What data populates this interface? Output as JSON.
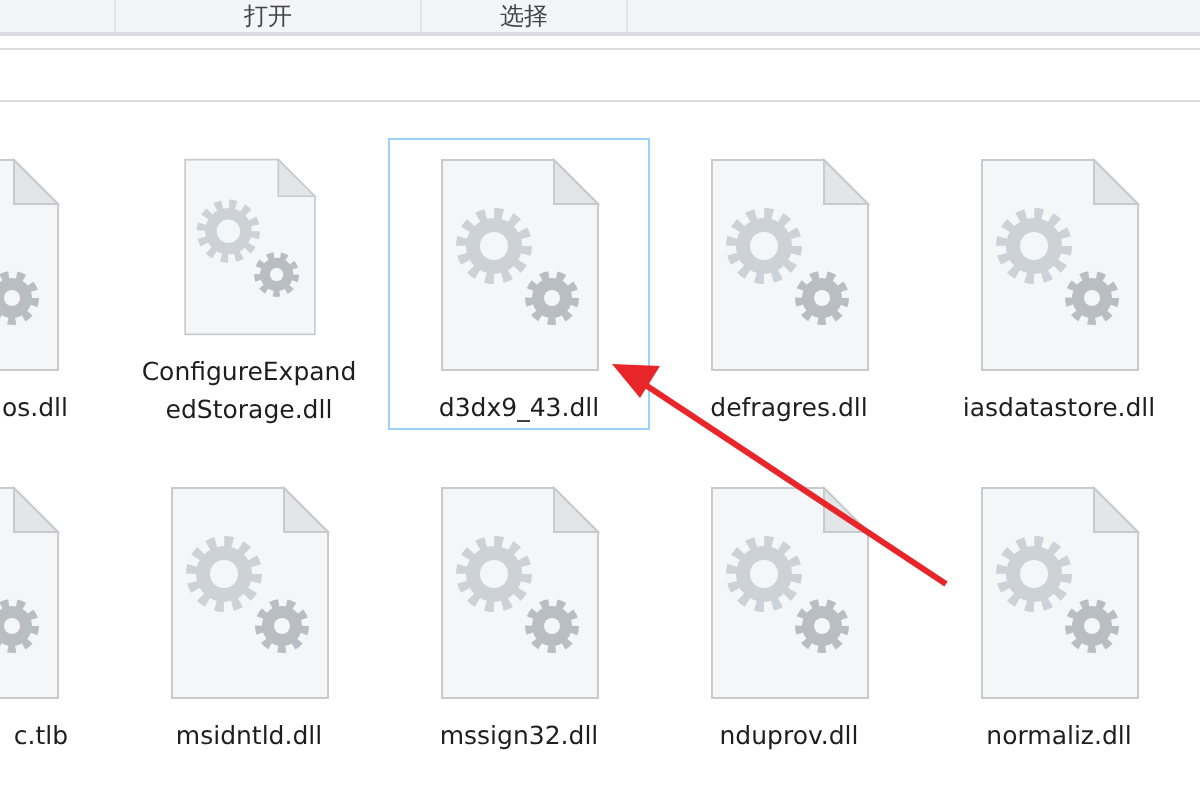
{
  "ribbon": {
    "groups": [
      {
        "label": "打开"
      },
      {
        "label": "选择"
      }
    ]
  },
  "files": [
    {
      "name": "os.dll",
      "selected": false
    },
    {
      "name": "ConfigureExpandedStorage.dll",
      "selected": false
    },
    {
      "name": "d3dx9_43.dll",
      "selected": true
    },
    {
      "name": "defragres.dll",
      "selected": false
    },
    {
      "name": "iasdatastore.dll",
      "selected": false
    },
    {
      "name": "c.tlb",
      "selected": false
    },
    {
      "name": "msidntld.dll",
      "selected": false
    },
    {
      "name": "mssign32.dll",
      "selected": false
    },
    {
      "name": "nduprov.dll",
      "selected": false
    },
    {
      "name": "normaliz.dll",
      "selected": false
    }
  ]
}
